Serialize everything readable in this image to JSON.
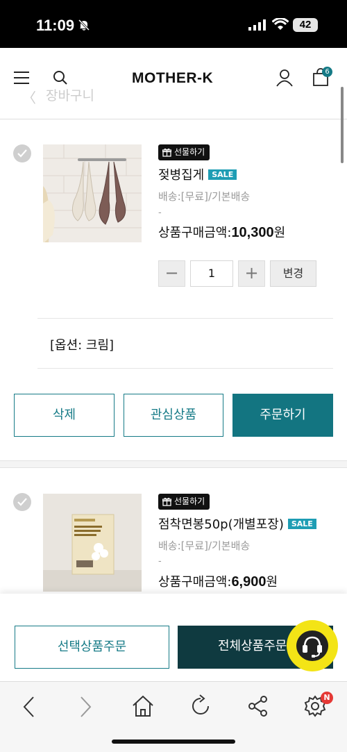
{
  "status": {
    "time": "11:09",
    "battery": "42"
  },
  "header": {
    "logo": "MOTHER-K",
    "back_title": "장바구니",
    "cart_count": "6"
  },
  "items": [
    {
      "gift_label": "선물하기",
      "name": "젖병집게",
      "sale_badge": "SALE",
      "shipping": "배송:[무료]/기본배송",
      "dash": "-",
      "price_label": "상품구매금액:",
      "price_value": "10,300",
      "price_unit": "원",
      "quantity": "1",
      "minus": "−",
      "plus": "+",
      "change_label": "변경",
      "option": "[옵션: 크림]",
      "delete_label": "삭제",
      "wishlist_label": "관심상품",
      "order_label": "주문하기"
    },
    {
      "gift_label": "선물하기",
      "name": "점착면봉50p(개별포장)",
      "sale_badge": "SALE",
      "shipping": "배송:[무료]/기본배송",
      "dash": "-",
      "price_label": "상품구매금액:",
      "price_value": "6,900",
      "price_unit": "원"
    }
  ],
  "footer": {
    "order_selected": "선택상품주문",
    "order_all": "전체상품주문"
  },
  "browser": {
    "notif_badge": "N"
  },
  "icons": [
    "bell-slash-icon",
    "signal-icon",
    "wifi-icon",
    "menu-icon",
    "search-icon",
    "user-icon",
    "bag-icon",
    "back-icon",
    "check-icon",
    "gift-icon",
    "chat-headset-icon",
    "nav-back-icon",
    "nav-forward-icon",
    "home-icon",
    "reload-icon",
    "share-icon",
    "settings-icon"
  ],
  "colors": {
    "accent": "#157a86",
    "dark_button": "#0f3a40",
    "sale": "#1e9db4",
    "chat": "#f3e416"
  }
}
